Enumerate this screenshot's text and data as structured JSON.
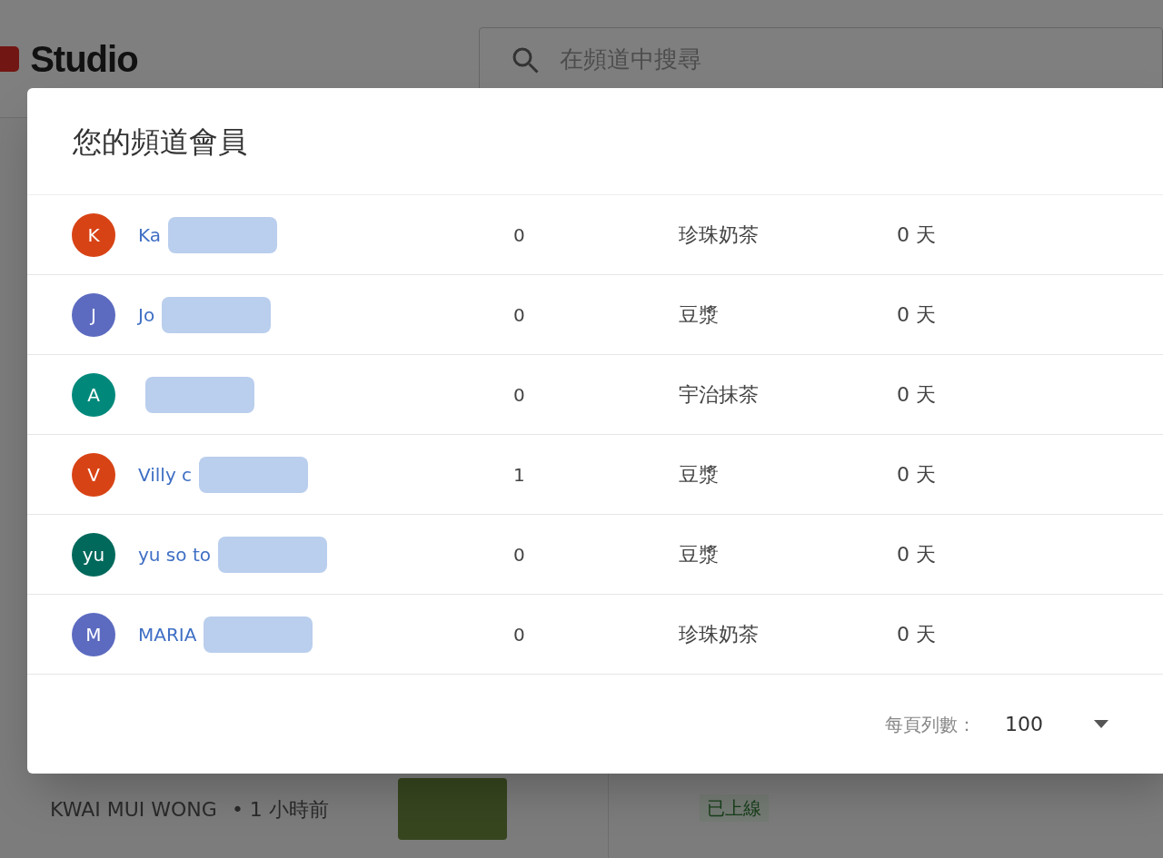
{
  "header": {
    "logo": "Studio",
    "search": {
      "placeholder": "在頻道中搜尋"
    }
  },
  "background_feed": {
    "author": "KWAI MUI WONG",
    "time": "• 1 小時前",
    "status": "已上線"
  },
  "dialog": {
    "title": "您的頻道會員",
    "members": [
      {
        "initial": "K",
        "color": "#d84315",
        "name": "Ka",
        "column_2": "0",
        "column_3": "珍珠奶茶",
        "column_4": "0 天"
      },
      {
        "initial": "J",
        "color": "#5c6bc0",
        "name": "Jo",
        "column_2": "0",
        "column_3": "豆漿",
        "column_4": "0 天"
      },
      {
        "initial": "A",
        "color": "#00897b",
        "column_2": "0",
        "column_3": "宇治抹茶",
        "column_4": "0 天"
      },
      {
        "initial": "V",
        "color": "#d84315",
        "name": "Villy c",
        "column_2": "1",
        "column_3": "豆漿",
        "column_4": "0 天"
      },
      {
        "initial": "yu",
        "color": "#00695c",
        "name": "yu so to",
        "column_2": "0",
        "column_3": "豆漿",
        "column_4": "0 天"
      },
      {
        "initial": "M",
        "color": "#5c6bc0",
        "name": "MARIA",
        "column_2": "0",
        "column_3": "珍珠奶茶",
        "column_4": "0 天"
      }
    ],
    "footer": {
      "rows_per_page_label": "每頁列數：",
      "rows_per_page": "100"
    }
  }
}
